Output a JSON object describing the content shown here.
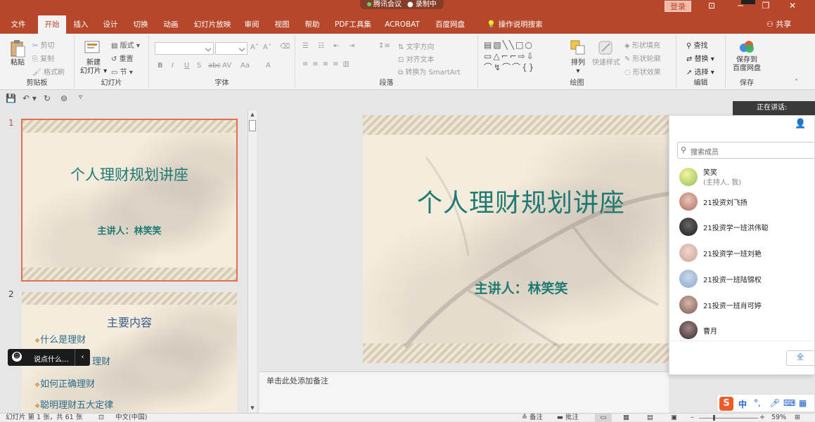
{
  "titlebar": {
    "meeting_app": "腾讯会议",
    "recording": "录制中",
    "login": "登录"
  },
  "tabs": [
    {
      "label": "文件",
      "active": false
    },
    {
      "label": "开始",
      "active": true
    },
    {
      "label": "插入",
      "active": false
    },
    {
      "label": "设计",
      "active": false
    },
    {
      "label": "切换",
      "active": false
    },
    {
      "label": "动画",
      "active": false
    },
    {
      "label": "幻灯片放映",
      "active": false
    },
    {
      "label": "审阅",
      "active": false
    },
    {
      "label": "视图",
      "active": false
    },
    {
      "label": "帮助",
      "active": false
    },
    {
      "label": "PDF工具集",
      "active": false
    },
    {
      "label": "ACROBAT",
      "active": false
    },
    {
      "label": "百度网盘",
      "active": false
    },
    {
      "label": "操作说明搜索",
      "active": false
    }
  ],
  "share_label": "共享",
  "ribbon": {
    "clipboard": {
      "paste": "粘贴",
      "cut": "剪切",
      "copy": "复制",
      "format_painter": "格式刷",
      "group": "剪贴板"
    },
    "slides": {
      "new_slide_line1": "新建",
      "new_slide_line2": "幻灯片",
      "layout": "版式",
      "reset": "重置",
      "section": "节",
      "group": "幻灯片"
    },
    "font": {
      "bold": "B",
      "italic": "I",
      "underline": "U",
      "shadow": "S",
      "strike": "abc",
      "spacing": "AV",
      "case": "Aa",
      "color": "A",
      "group": "字体"
    },
    "paragraph": {
      "text_direction": "文字方向",
      "align_text": "对齐文本",
      "smartart": "转换为 SmartArt",
      "group": "段落"
    },
    "drawing": {
      "arrange": "排列",
      "quick_styles": "快速样式",
      "shape_fill": "形状填充",
      "shape_outline": "形状轮廓",
      "shape_effects": "形状效果",
      "group": "绘图"
    },
    "editing": {
      "find": "查找",
      "replace": "替换",
      "select": "选择",
      "group": "编辑"
    },
    "save": {
      "line1": "保存到",
      "line2": "百度网盘",
      "group": "保存"
    }
  },
  "thumbnails": [
    {
      "number": "1",
      "title": "个人理财规划讲座",
      "subtitle": "主讲人：林笑笑"
    },
    {
      "number": "2",
      "title": "主要内容",
      "bullets": [
        "什么是理财",
        "理财",
        "如何正确理财",
        "聪明理财五大定律"
      ]
    }
  ],
  "slide": {
    "title": "个人理财规划讲座",
    "subtitle": "主讲人：林笑笑"
  },
  "notes_placeholder": "单击此处添加备注",
  "members_panel": {
    "speaking": "正在讲话:",
    "search_placeholder": "搜索成员",
    "members": [
      {
        "name": "笑笑",
        "role": "(主持人, 我)",
        "color": "#c9d86a"
      },
      {
        "name": "21投资刘飞扬",
        "color": "#b36a5e"
      },
      {
        "name": "21投资学一班洪伟聪",
        "color": "#2a2a2a"
      },
      {
        "name": "21投资学一班刘艳",
        "color": "#c9a29a"
      },
      {
        "name": "21投资一班陆锦权",
        "color": "#8ea9c8"
      },
      {
        "name": "21投资一班肖可婷",
        "color": "#7a5a52"
      },
      {
        "name": "曹月",
        "color": "#4a3a3a"
      }
    ],
    "all_button": "全"
  },
  "chat": {
    "placeholder": "说点什么..."
  },
  "ime": {
    "lang": "中"
  },
  "status": {
    "slide_info": "幻灯片 第 1 张，共 61 张",
    "language": "中文(中国)",
    "notes": "备注",
    "comments": "批注",
    "zoom": "59%"
  }
}
